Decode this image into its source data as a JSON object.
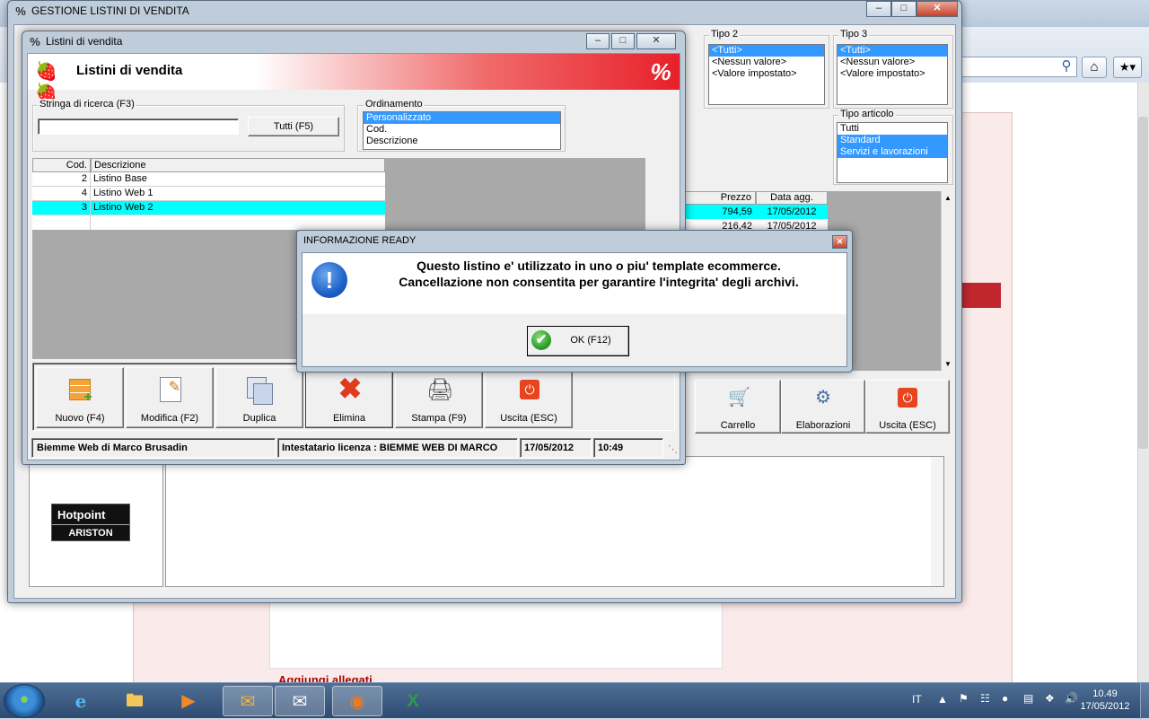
{
  "main_window": {
    "title": "GESTIONE LISTINI DI VENDITA",
    "tipo2": {
      "label": "Tipo 2",
      "items": [
        "<Tutti>",
        "<Nessun valore>",
        "<Valore impostato>"
      ],
      "selected": 0
    },
    "tipo3": {
      "label": "Tipo 3",
      "items": [
        "<Tutti>",
        "<Nessun valore>",
        "<Valore impostato>"
      ],
      "selected": 0
    },
    "tipo_articolo": {
      "label": "Tipo articolo",
      "items": [
        "Tutti",
        "Standard",
        "Servizi e lavorazioni"
      ],
      "selected": [
        1,
        2
      ]
    },
    "grid": {
      "headers": [
        "Prezzo",
        "Data agg."
      ],
      "rows": [
        {
          "prezzo": "794,59",
          "data": "17/05/2012"
        },
        {
          "prezzo": "216,42",
          "data": "17/05/2012"
        }
      ]
    },
    "buttons": {
      "carrello": "Carrello",
      "elaborazioni": "Elaborazioni",
      "uscita": "Uscita (ESC)"
    },
    "logo": {
      "line1": "Hotpoint",
      "line2": "ARISTON"
    }
  },
  "sub_window": {
    "title": "Listini di vendita",
    "header_title": "Listini di vendita",
    "search": {
      "label": "Stringa di ricerca (F3)",
      "value": "",
      "tutti_button": "Tutti (F5)"
    },
    "ordinamento": {
      "label": "Ordinamento",
      "items": [
        "Personalizzato",
        "Cod.",
        "Descrizione"
      ],
      "selected": 0
    },
    "table": {
      "headers": [
        "Cod.",
        "Descrizione"
      ],
      "rows": [
        {
          "cod": "2",
          "descrizione": "Listino Base"
        },
        {
          "cod": "4",
          "descrizione": "Listino Web 1"
        },
        {
          "cod": "3",
          "descrizione": "Listino Web 2"
        },
        {
          "cod": "",
          "descrizione": ""
        }
      ],
      "selected_row": 2
    },
    "toolbar": {
      "nuovo": "Nuovo (F4)",
      "modifica": "Modifica (F2)",
      "duplica": "Duplica",
      "elimina": "Elimina",
      "stampa": "Stampa (F9)",
      "uscita": "Uscita (ESC)"
    },
    "status": {
      "company": "Biemme Web di Marco Brusadin",
      "license": "Intestatario licenza : BIEMME WEB DI MARCO",
      "date": "17/05/2012",
      "time": "10:49"
    }
  },
  "dialog": {
    "title": "INFORMAZIONE READY",
    "message_line1": "Questo listino e' utilizzato in uno o piu' template ecommerce.",
    "message_line2": "Cancellazione non consentita per garantire l'integrita' degli archivi.",
    "ok_button": "OK (F12)"
  },
  "browser": {
    "bottom_text": "Aggiungi allegati"
  },
  "taskbar": {
    "language": "IT",
    "time": "10.49",
    "date": "17/05/2012"
  },
  "colors": {
    "selection": "#3399ff",
    "row_highlight": "#00ffff",
    "header_red": "#e8202a",
    "dialog_icon": "#1e62c8"
  }
}
